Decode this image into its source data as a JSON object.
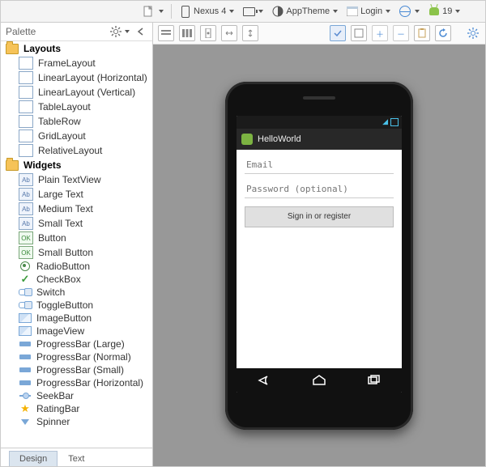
{
  "palette": {
    "title": "Palette",
    "sections": [
      {
        "title": "Layouts",
        "items": [
          "FrameLayout",
          "LinearLayout (Horizontal)",
          "LinearLayout (Vertical)",
          "TableLayout",
          "TableRow",
          "GridLayout",
          "RelativeLayout"
        ],
        "icon": "box"
      },
      {
        "title": "Widgets",
        "items": [
          "Plain TextView",
          "Large Text",
          "Medium Text",
          "Small Text",
          "Button",
          "Small Button",
          "RadioButton",
          "CheckBox",
          "Switch",
          "ToggleButton",
          "ImageButton",
          "ImageView",
          "ProgressBar (Large)",
          "ProgressBar (Normal)",
          "ProgressBar (Small)",
          "ProgressBar (Horizontal)",
          "SeekBar",
          "RatingBar",
          "Spinner"
        ]
      }
    ]
  },
  "bottom_tabs": {
    "design": "Design",
    "text": "Text"
  },
  "top_toolbar": {
    "device": "Nexus 4",
    "theme": "AppTheme",
    "login": "Login",
    "api": "19"
  },
  "preview": {
    "app_title": "HelloWorld",
    "email_placeholder": "Email",
    "password_placeholder": "Password (optional)",
    "signin_label": "Sign in or register"
  }
}
